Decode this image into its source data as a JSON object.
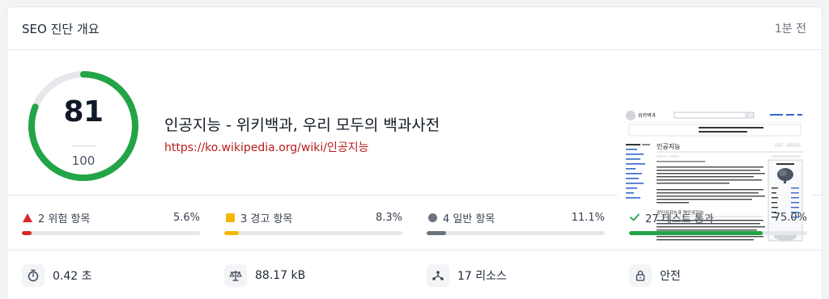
{
  "header": {
    "title": "SEO 진단 개요",
    "time": "1분 전"
  },
  "score": {
    "value": "81",
    "max": "100",
    "fraction": 0.81
  },
  "colors": {
    "good": "#22a447",
    "critical": "#dc2626",
    "warning": "#f5b800",
    "info": "#6b7280",
    "track": "#e5e7eb"
  },
  "page": {
    "title": "인공지능 - 위키백과, 우리 모두의 백과사전",
    "url": "https://ko.wikipedia.org/wiki/인공지능"
  },
  "issues": [
    {
      "label": "2 위험 항목",
      "pct": "5.6%",
      "value": 5.6,
      "icon": "triangle-warning-icon",
      "color": "#dc2626"
    },
    {
      "label": "3 경고 항목",
      "pct": "8.3%",
      "value": 8.3,
      "icon": "square-warning-icon",
      "color": "#f5b800"
    },
    {
      "label": "4 일반 항목",
      "pct": "11.1%",
      "value": 11.1,
      "icon": "circle-info-icon",
      "color": "#6b7280"
    },
    {
      "label": "27 테스트 통과",
      "pct": "75.0%",
      "value": 75.0,
      "icon": "check-icon",
      "color": "#22a447"
    }
  ],
  "stats": [
    {
      "label": "0.42 초",
      "icon": "stopwatch-icon"
    },
    {
      "label": "88.17 kB",
      "icon": "scale-icon"
    },
    {
      "label": "17 리소스",
      "icon": "network-icon"
    },
    {
      "label": "안전",
      "icon": "lock-icon"
    }
  ],
  "thumbnail": {
    "site": "위키백과",
    "heading": "인공지능",
    "section": "강인공지능과 약인공지능"
  }
}
